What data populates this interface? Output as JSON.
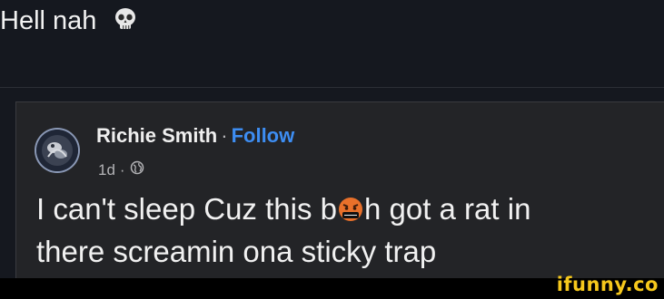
{
  "caption": {
    "text": "Hell nah",
    "icon": "skull-icon"
  },
  "post": {
    "author": "Richie Smith",
    "separator": "·",
    "follow_label": "Follow",
    "time": "1d",
    "meta_separator": "·",
    "privacy_icon": "globe-icon",
    "text_line1_part1": "I can't sleep Cuz this b",
    "text_line1_emoji": "angry-face-icon",
    "text_line1_part2": "h got a rat in",
    "text_line2": "there screamin ona sticky trap"
  },
  "watermark": {
    "text": "ifunny.co"
  },
  "colors": {
    "background": "#15181f",
    "card": "#232427",
    "link": "#3d8df2",
    "watermark": "#f6c81c"
  }
}
